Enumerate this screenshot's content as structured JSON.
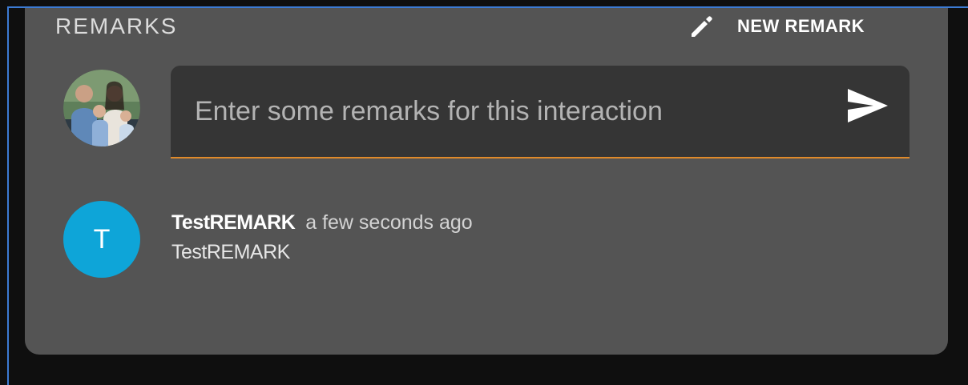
{
  "remarks_panel": {
    "title": "REMARKS",
    "new_remark_label": "NEW REMARK",
    "new_remark_icon": "pencil-icon"
  },
  "composer": {
    "placeholder": "Enter some remarks for this interaction",
    "value": "",
    "send_icon": "send-icon",
    "avatar_icon": "user-photo-avatar"
  },
  "remarks": [
    {
      "avatar_letter": "T",
      "author": "TestREMARK",
      "time": "a few seconds ago",
      "text": "TestREMARK"
    }
  ],
  "colors": {
    "card_background": "#545454",
    "input_background": "#353535",
    "input_underline": "#e08a2a",
    "avatar_accent": "#0ea5d8",
    "page_background": "#0f0f0f",
    "frame_accent": "#3c7bd4"
  }
}
